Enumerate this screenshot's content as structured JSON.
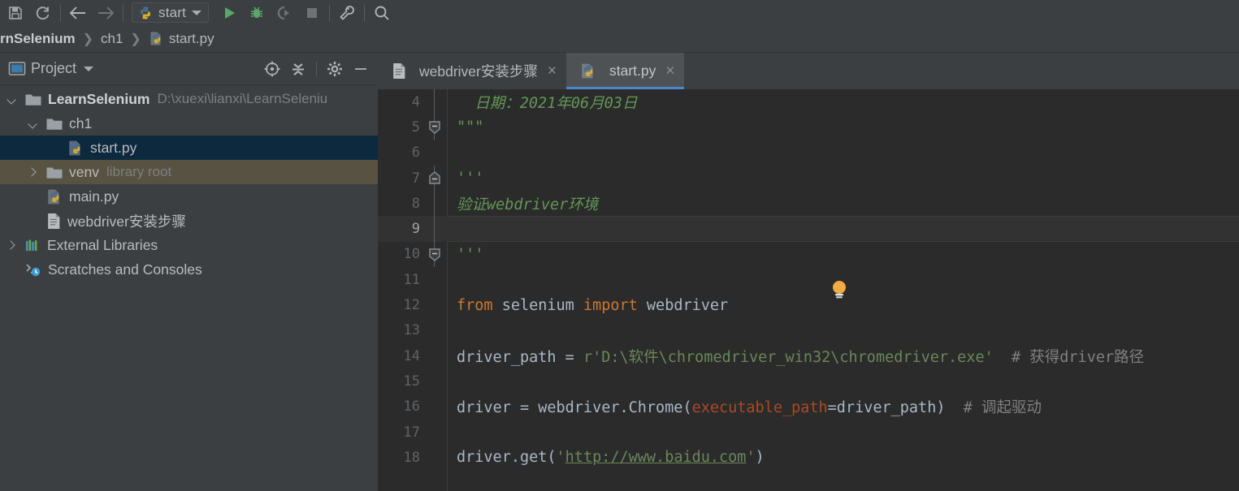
{
  "toolbar": {
    "icons": [
      {
        "name": "save-all-icon",
        "title": "Save All"
      },
      {
        "name": "sync-refresh-icon",
        "title": "Synchronize"
      },
      {
        "name": "back-arrow-icon",
        "title": "Back"
      },
      {
        "name": "forward-arrow-icon",
        "title": "Forward"
      }
    ],
    "run_config": {
      "label": "start",
      "icon": "python-file-icon"
    },
    "actions": [
      {
        "name": "run-icon",
        "title": "Run",
        "color": "#59a869"
      },
      {
        "name": "debug-icon",
        "title": "Debug",
        "color": "#59a869"
      },
      {
        "name": "run-with-coverage-icon",
        "title": "Run with Coverage"
      },
      {
        "name": "stop-icon",
        "title": "Stop"
      },
      {
        "name": "settings-wrench-icon",
        "title": "Settings"
      },
      {
        "name": "search-everywhere-icon",
        "title": "Search Everywhere"
      }
    ]
  },
  "breadcrumb": {
    "items": [
      "rnSelenium",
      "ch1",
      "start.py"
    ],
    "separator": "❯"
  },
  "project_panel": {
    "title": "Project",
    "header_icons": [
      {
        "name": "select-opened-file-icon"
      },
      {
        "name": "collapse-all-icon"
      },
      {
        "name": "gear-icon"
      },
      {
        "name": "hide-icon"
      }
    ],
    "tree": [
      {
        "label": "LearnSelenium",
        "sub": "D:\\xuexi\\lianxi\\LearnSeleniu",
        "indent": 0,
        "arrow": "open",
        "icon": "folder-icon",
        "bold": true,
        "state": "normal"
      },
      {
        "label": "ch1",
        "sub": "",
        "indent": 1,
        "arrow": "open",
        "icon": "folder-icon",
        "bold": false,
        "state": "normal"
      },
      {
        "label": "start.py",
        "sub": "",
        "indent": 2,
        "arrow": "none",
        "icon": "python-file-icon",
        "bold": false,
        "state": "selected"
      },
      {
        "label": "venv",
        "sub": "library root",
        "indent": 1,
        "arrow": "closed",
        "icon": "folder-icon",
        "bold": false,
        "state": "libroot"
      },
      {
        "label": "main.py",
        "sub": "",
        "indent": 1,
        "arrow": "none",
        "icon": "python-file-icon",
        "bold": false,
        "state": "normal"
      },
      {
        "label": "webdriver安装步骤",
        "sub": "",
        "indent": 1,
        "arrow": "none",
        "icon": "text-file-icon",
        "bold": false,
        "state": "normal"
      },
      {
        "label": "External Libraries",
        "sub": "",
        "indent": 0,
        "arrow": "closed",
        "icon": "libraries-icon",
        "bold": false,
        "state": "normal"
      },
      {
        "label": "Scratches and Consoles",
        "sub": "",
        "indent": 0,
        "arrow": "none",
        "icon": "scratches-icon",
        "bold": false,
        "state": "normal"
      }
    ]
  },
  "editor": {
    "tabs": [
      {
        "label": "webdriver安装步骤",
        "icon": "text-file-icon",
        "active": false,
        "close": "×"
      },
      {
        "label": "start.py",
        "icon": "python-file-icon",
        "active": true,
        "close": "×"
      }
    ],
    "current_line": 9,
    "intention_bulb": {
      "name": "intention-bulb-icon",
      "line": 8
    },
    "lines": [
      {
        "num": "4",
        "fold": "none",
        "foldline": true,
        "tokens": [
          {
            "t": "  日期：2021年06月03日",
            "c": "doc"
          }
        ]
      },
      {
        "num": "5",
        "fold": "start",
        "foldline": true,
        "tokens": [
          {
            "t": "\"\"\"",
            "c": "doc"
          }
        ]
      },
      {
        "num": "6",
        "fold": "none",
        "foldline": false,
        "tokens": []
      },
      {
        "num": "7",
        "fold": "end",
        "foldline": true,
        "tokens": [
          {
            "t": "'''",
            "c": "doc"
          }
        ]
      },
      {
        "num": "8",
        "fold": "none",
        "foldline": true,
        "tokens": [
          {
            "t": "验证webdriver环境",
            "c": "doc"
          }
        ]
      },
      {
        "num": "9",
        "fold": "none",
        "foldline": true,
        "tokens": []
      },
      {
        "num": "10",
        "fold": "start",
        "foldline": true,
        "tokens": [
          {
            "t": "'''",
            "c": "doc"
          }
        ]
      },
      {
        "num": "11",
        "fold": "none",
        "foldline": false,
        "tokens": []
      },
      {
        "num": "12",
        "fold": "none",
        "foldline": false,
        "tokens": [
          {
            "t": "from",
            "c": "kw"
          },
          {
            "t": " selenium ",
            "c": "txt"
          },
          {
            "t": "import",
            "c": "kw"
          },
          {
            "t": " webdriver",
            "c": "txt"
          }
        ]
      },
      {
        "num": "13",
        "fold": "none",
        "foldline": false,
        "tokens": []
      },
      {
        "num": "14",
        "fold": "none",
        "foldline": false,
        "tokens": [
          {
            "t": "driver_path = ",
            "c": "txt"
          },
          {
            "t": "r'D:\\软件\\chromedriver_win32\\chromedriver.exe'",
            "c": "str"
          },
          {
            "t": "  # 获得driver路径",
            "c": "cmt"
          }
        ]
      },
      {
        "num": "15",
        "fold": "none",
        "foldline": false,
        "tokens": []
      },
      {
        "num": "16",
        "fold": "none",
        "foldline": false,
        "tokens": [
          {
            "t": "driver = webdriver.Chrome(",
            "c": "txt"
          },
          {
            "t": "executable_path",
            "c": "kwarg"
          },
          {
            "t": "=driver_path)",
            "c": "txt"
          },
          {
            "t": "  # 调起驱动",
            "c": "cmt"
          }
        ]
      },
      {
        "num": "17",
        "fold": "none",
        "foldline": false,
        "tokens": []
      },
      {
        "num": "18",
        "fold": "none",
        "foldline": false,
        "tokens": [
          {
            "t": "driver.get(",
            "c": "txt"
          },
          {
            "t": "'",
            "c": "str"
          },
          {
            "t": "http://www.baidu.com",
            "c": "lnk"
          },
          {
            "t": "'",
            "c": "str"
          },
          {
            "t": ")",
            "c": "txt"
          }
        ]
      }
    ]
  },
  "colors": {
    "toolbar_bg": "#3c3f41",
    "editor_bg": "#2b2b2b",
    "selection_bg": "#0d293e",
    "libroot_bg": "#575241",
    "tab_active_underline": "#4a88c7",
    "keyword": "#cc7832",
    "string": "#6a8759",
    "docstring": "#629755",
    "comment": "#808080",
    "default_text": "#a9b7c6"
  }
}
